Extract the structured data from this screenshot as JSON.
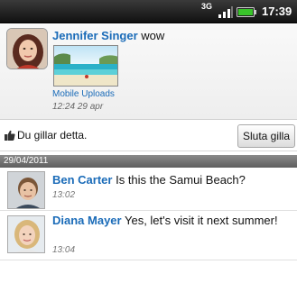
{
  "status_bar": {
    "network": "3G",
    "time": "17:39"
  },
  "post": {
    "author": "Jennifer Singer",
    "message": "wow",
    "album": "Mobile Uploads",
    "timestamp": "12:24 29 apr"
  },
  "like_row": {
    "text": "Du gillar detta.",
    "unlike_label": "Sluta gilla"
  },
  "divider": {
    "date": "29/04/2011"
  },
  "comments": [
    {
      "author": "Ben Carter",
      "text": "Is this the Samui Beach?",
      "time": "13:02"
    },
    {
      "author": "Diana Mayer",
      "text": "Yes, let's visit it next summer!",
      "time": "13:04"
    }
  ],
  "colors": {
    "link": "#1a6bb8"
  }
}
